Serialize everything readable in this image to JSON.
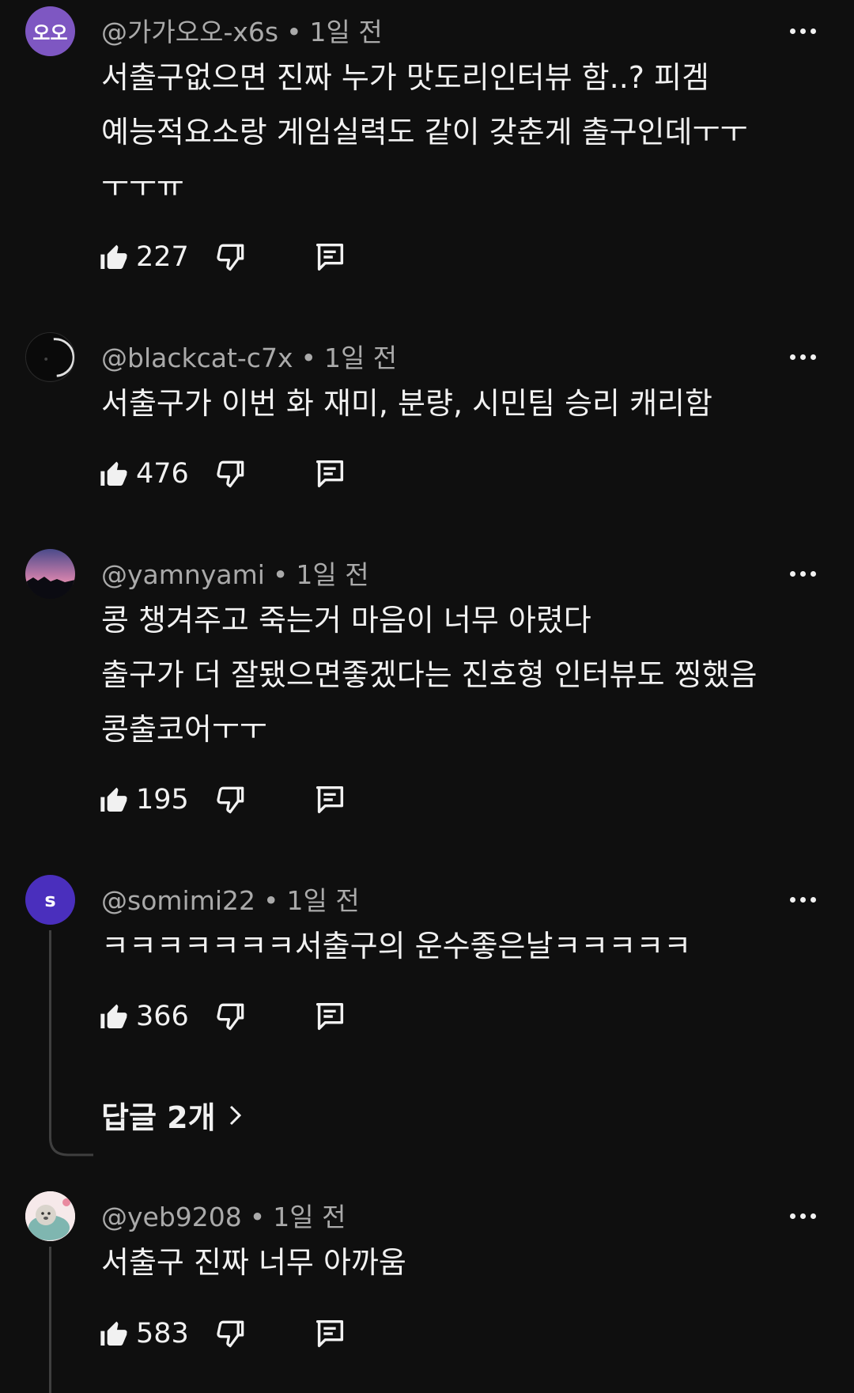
{
  "comments": [
    {
      "author": "@가가오오-x6s",
      "time": "1일 전",
      "avatar_text": "오오",
      "avatar_color": "#7e57c2",
      "text": "서출구없으면 진짜 누가 맛도리인터뷰 함..? 피겜\n예능적요소랑 게임실력도 같이 갖춘게 출구인데ㅜㅜ\nㅜㅜㅠ",
      "likes": "227"
    },
    {
      "author": "@blackcat-c7x",
      "time": "1일 전",
      "text": "서출구가 이번 화 재미, 분량, 시민팀 승리 캐리함",
      "likes": "476"
    },
    {
      "author": "@yamnyami",
      "time": "1일 전",
      "text": "콩 챙겨주고 죽는거 마음이 너무 아렸다\n출구가 더 잘됐으면좋겠다는 진호형 인터뷰도 찡했음\n콩출코어ㅜㅜ",
      "likes": "195"
    },
    {
      "author": "@somimi22",
      "time": "1일 전",
      "avatar_text": "s",
      "avatar_color": "#4a2fbd",
      "text": "ㅋㅋㅋㅋㅋㅋㅋ서출구의 운수좋은날ㅋㅋㅋㅋㅋ",
      "likes": "366",
      "replies_label": "답글 2개"
    },
    {
      "author": "@yeb9208",
      "time": "1일 전",
      "text": "서출구 진짜 너무 아까움",
      "likes": "583"
    }
  ],
  "icons": {
    "like": "thumbs-up-icon",
    "dislike": "thumbs-down-icon",
    "reply": "comment-icon",
    "more": "more-icon",
    "chevron": "chevron-right-icon"
  }
}
